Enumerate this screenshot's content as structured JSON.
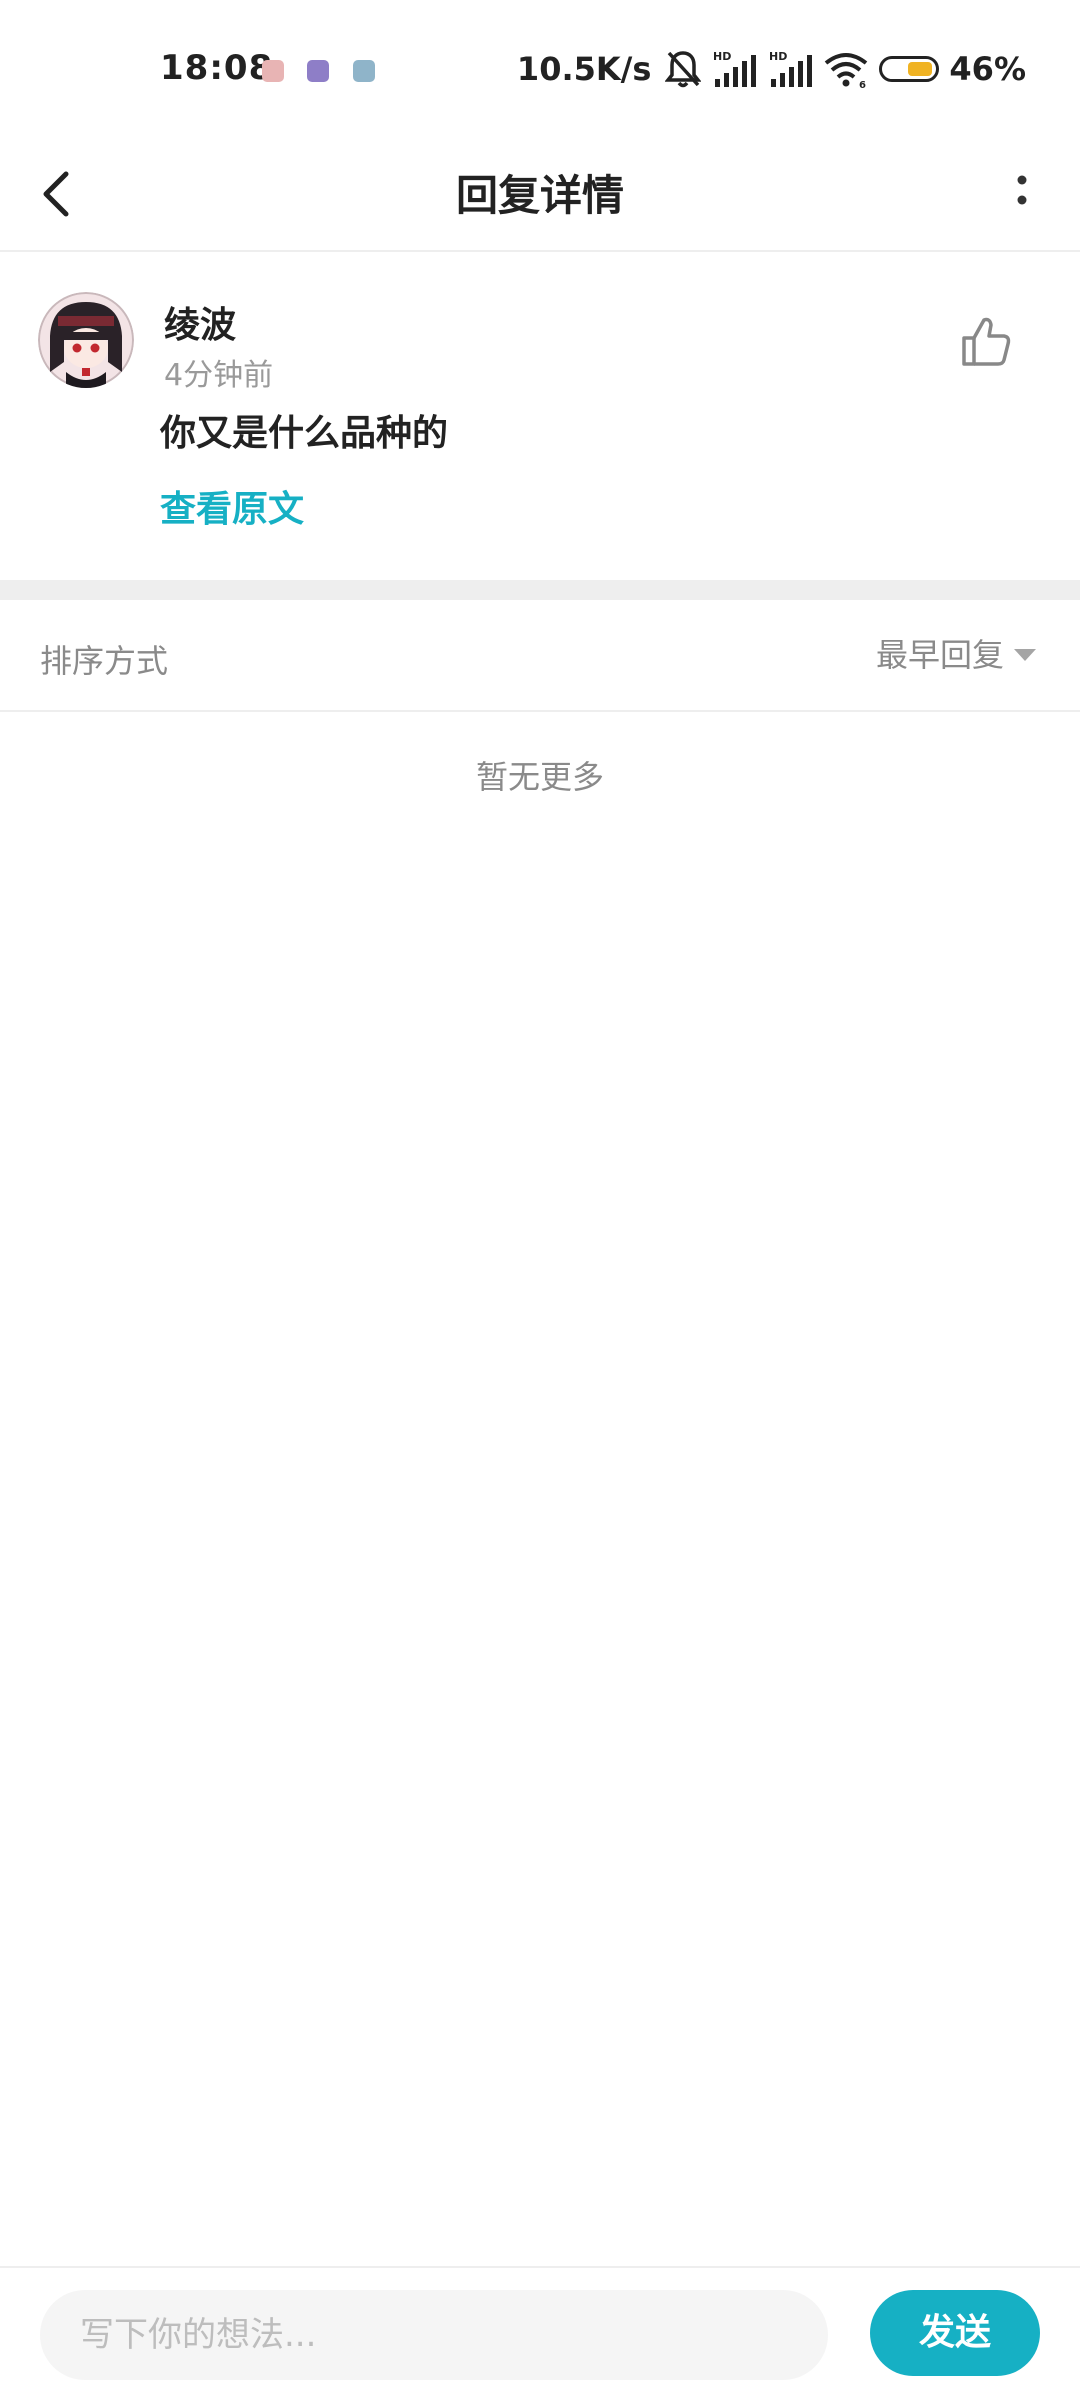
{
  "status_bar": {
    "time": "18:08",
    "network_speed": "10.5K/s",
    "battery_percent": "46%",
    "battery_level": 0.46,
    "notification_icons": [
      "app-notification-icon",
      "app-notification-icon",
      "app-notification-icon"
    ],
    "icons": [
      "bell-muted-icon",
      "signal-hd-icon",
      "signal-hd-icon",
      "wifi-icon",
      "battery-icon"
    ]
  },
  "nav": {
    "title": "回复详情",
    "back_icon": "chevron-left-icon",
    "more_icon": "more-vertical-icon"
  },
  "reply": {
    "user_name": "绫波",
    "time_ago": "4分钟前",
    "text": "你又是什么品种的",
    "view_original": "查看原文",
    "like_icon": "thumbs-up-icon"
  },
  "sort": {
    "label": "排序方式",
    "selected": "最早回复"
  },
  "list": {
    "empty_text": "暂无更多"
  },
  "composer": {
    "placeholder": "写下你的想法...",
    "send_label": "发送"
  },
  "colors": {
    "accent": "#16b0c4",
    "muted_text": "#8a8a8a",
    "battery_fill": "#f0b323"
  }
}
